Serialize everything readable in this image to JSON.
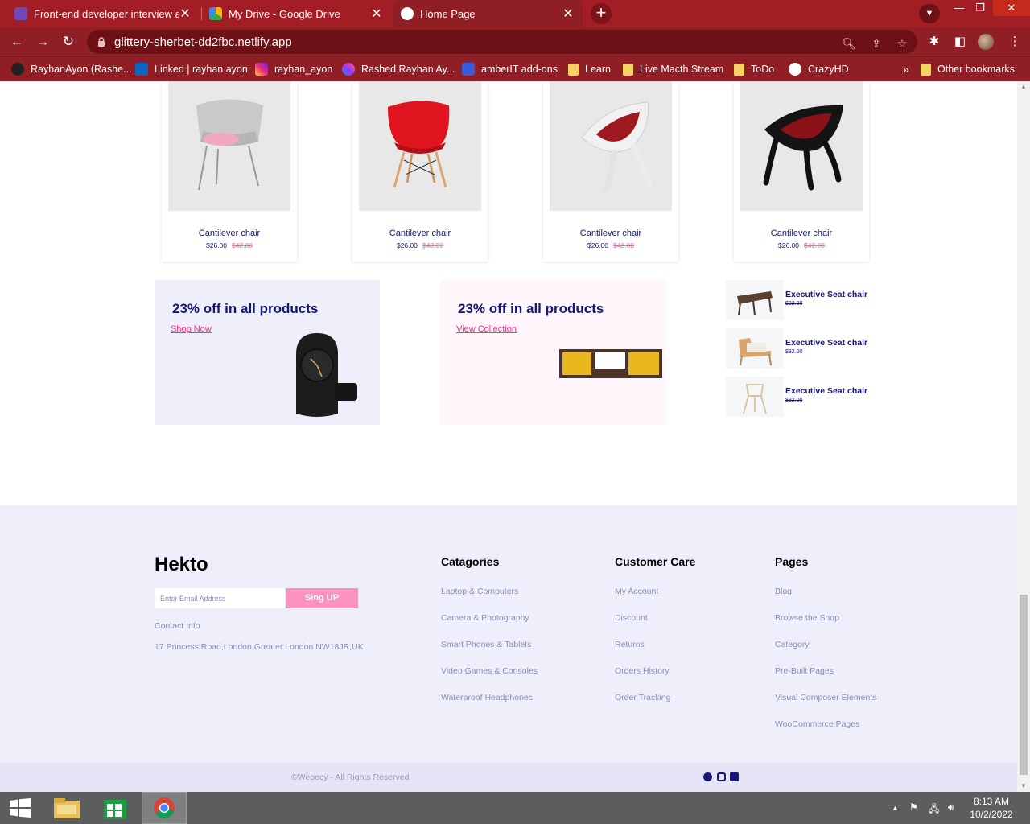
{
  "browser": {
    "tabs": [
      {
        "title": "Front-end developer interview as",
        "active": false
      },
      {
        "title": "My Drive - Google Drive",
        "active": false
      },
      {
        "title": "Home Page",
        "active": true
      }
    ],
    "url": "glittery-sherbet-dd2fbc.netlify.app",
    "bookmarks": [
      {
        "label": "RayhanAyon (Rashe..."
      },
      {
        "label": "Linked | rayhan ayon"
      },
      {
        "label": "rayhan_ayon"
      },
      {
        "label": "Rashed Rayhan Ay..."
      },
      {
        "label": "amberIT add-ons"
      },
      {
        "label": "Learn"
      },
      {
        "label": "Live Macth Stream"
      },
      {
        "label": "ToDo"
      },
      {
        "label": "CrazyHD"
      }
    ],
    "overflow": "»",
    "other_bookmarks": "Other bookmarks"
  },
  "products": [
    {
      "name": "Cantilever chair",
      "price": "$26.00",
      "old_price": "$42.00"
    },
    {
      "name": "Cantilever chair",
      "price": "$26.00",
      "old_price": "$42.00"
    },
    {
      "name": "Cantilever chair",
      "price": "$26.00",
      "old_price": "$42.00"
    },
    {
      "name": "Cantilever chair",
      "price": "$26.00",
      "old_price": "$42.00"
    }
  ],
  "promos": [
    {
      "title": "23% off in all products",
      "link": "Shop Now",
      "bg": "#eeeffb"
    },
    {
      "title": "23% off in all products",
      "link": "View Collection",
      "bg": "#fff6fb"
    }
  ],
  "mini_products": [
    {
      "name": "Executive Seat chair",
      "price": "$32.00"
    },
    {
      "name": "Executive Seat chair",
      "price": "$32.00"
    },
    {
      "name": "Executive Seat chair",
      "price": "$32.00"
    }
  ],
  "footer": {
    "brand": "Hekto",
    "email_placeholder": "Enter Email Address",
    "signup": "Sing UP",
    "contact_label": "Contact Info",
    "address": "17 Princess Road,London,Greater London NW18JR,UK",
    "columns": [
      {
        "heading": "Catagories",
        "links": [
          "Laptop & Computers",
          "Camera & Photography",
          "Smart Phones & Tablets",
          "Video Games & Consoles",
          "Waterproof Headphones"
        ]
      },
      {
        "heading": "Customer Care",
        "links": [
          "My Account",
          "Discount",
          "Returns",
          "Orders History",
          "Order Tracking"
        ]
      },
      {
        "heading": "Pages",
        "links": [
          "Blog",
          "Browse the Shop",
          "Category",
          "Pre-Built Pages",
          "Visual Composer Elements",
          "WooCommerce Pages"
        ]
      }
    ],
    "copyright": "©Webecy - All Rights Reserved"
  },
  "taskbar": {
    "time": "8:13 AM",
    "date": "10/2/2022"
  },
  "colors": {
    "accent": "#fb2e86",
    "navy": "#151875",
    "chrome": "#a31d24"
  }
}
